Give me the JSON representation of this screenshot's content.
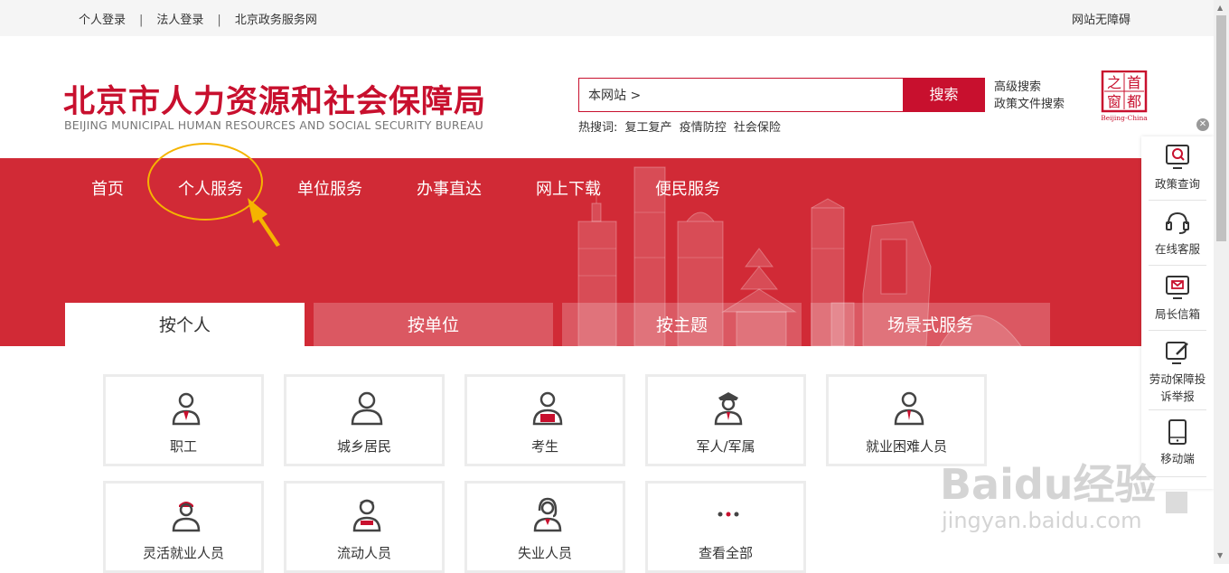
{
  "topbar": {
    "links": [
      "个人登录",
      "法人登录",
      "北京政务服务网"
    ],
    "separator": "|",
    "accessibility": "网站无障碍"
  },
  "header": {
    "title_cn": "北京市人力资源和社会保障局",
    "title_en": "BEIJING MUNICIPAL HUMAN RESOURCES AND SOCIAL SECURITY BUREAU",
    "search_value": "本网站 >",
    "search_button": "搜索",
    "advanced_search": "高级搜索",
    "policy_search": "政策文件搜索",
    "hot_label": "热搜词:",
    "hot_words": [
      "复工复产",
      "疫情防控",
      "社会保险"
    ],
    "seal_chars": [
      "首",
      "都",
      "之",
      "窗"
    ],
    "seal_caption": "Beijing-China"
  },
  "nav": [
    "首页",
    "个人服务",
    "单位服务",
    "办事直达",
    "网上下载",
    "便民服务"
  ],
  "tabs": [
    "按个人",
    "按单位",
    "按主题",
    "场景式服务"
  ],
  "cards": [
    {
      "label": "职工",
      "icon": "worker-icon"
    },
    {
      "label": "城乡居民",
      "icon": "resident-icon"
    },
    {
      "label": "考生",
      "icon": "examinee-icon"
    },
    {
      "label": "军人/军属",
      "icon": "soldier-icon"
    },
    {
      "label": "就业困难人员",
      "icon": "employment-difficulty-icon"
    },
    {
      "label": "灵活就业人员",
      "icon": "flexible-worker-icon"
    },
    {
      "label": "流动人员",
      "icon": "migrant-icon"
    },
    {
      "label": "失业人员",
      "icon": "unemployed-icon"
    },
    {
      "label": "查看全部",
      "icon": "more-icon"
    }
  ],
  "sidebar": [
    {
      "label": "政策查询",
      "icon": "policy-search-icon"
    },
    {
      "label": "在线客服",
      "icon": "headset-icon"
    },
    {
      "label": "局长信箱",
      "icon": "mailbox-icon"
    },
    {
      "label": "劳动保障投诉举报",
      "icon": "complaint-icon"
    },
    {
      "label": "移动端",
      "icon": "mobile-icon"
    }
  ],
  "watermark": {
    "main": "Baidu经验",
    "sub": "jingyan.baidu.com"
  },
  "colors": {
    "brand_red": "#c8102e",
    "banner_red": "#d12a36",
    "annotation": "#f5b400"
  }
}
